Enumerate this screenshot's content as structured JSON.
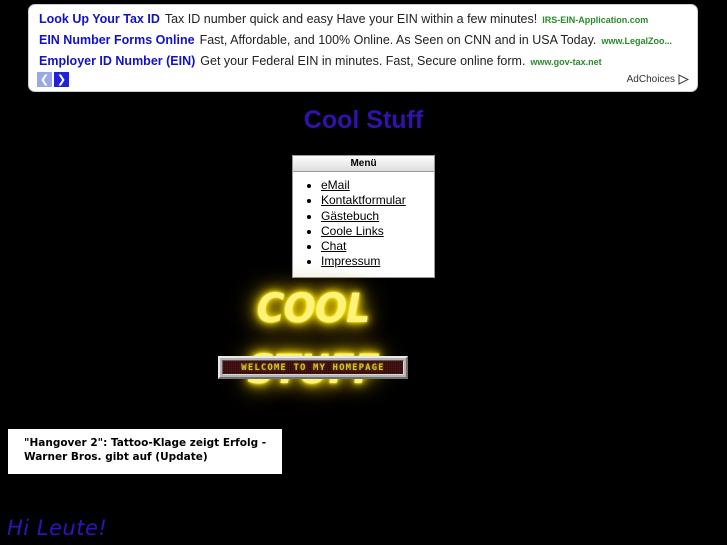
{
  "page": {
    "background_color": "#000000",
    "title": "Cool Stuff"
  },
  "ad": {
    "rows": [
      {
        "title": "Look Up Your Tax ID",
        "description": "Tax ID number quick and easy Have your EIN within a few minutes!",
        "url": "IRS-EIN-Application.com"
      },
      {
        "title": "EIN Number Forms Online",
        "description": "Fast, Affordable, and 100% Online. As Seen on CNN and in USA Today.",
        "url": "www.LegalZoo..."
      },
      {
        "title": "Employer ID Number (EIN)",
        "description": "Get your Federal EIN in minutes. Fast, Secure online form.",
        "url": "www.gov-tax.net"
      }
    ],
    "prev_arrow": "❮",
    "next_arrow": "❯",
    "adchoices_label": "AdChoices",
    "title_color": "#1111cc",
    "url_color": "#2a8a2a"
  },
  "menu": {
    "header": "Menü",
    "items": [
      {
        "label": "eMail"
      },
      {
        "label": "Kontaktformular"
      },
      {
        "label": "Gästebuch"
      },
      {
        "label": "Coole Links"
      },
      {
        "label": "Chat"
      },
      {
        "label": "Impressum"
      }
    ]
  },
  "neon_logo": {
    "text": "COOL STUFF",
    "color": "#ffee00"
  },
  "welcome_banner": {
    "text": "WELCOME TO MY HOMEPAGE",
    "led_color": "#d4c22a"
  },
  "news": {
    "headline": "\"Hangover 2\": Tattoo-Klage zeigt Erfolg - Warner Bros. gibt auf (Update)"
  },
  "greeting": {
    "text": "Hi Leute!",
    "color": "#3311bb"
  }
}
